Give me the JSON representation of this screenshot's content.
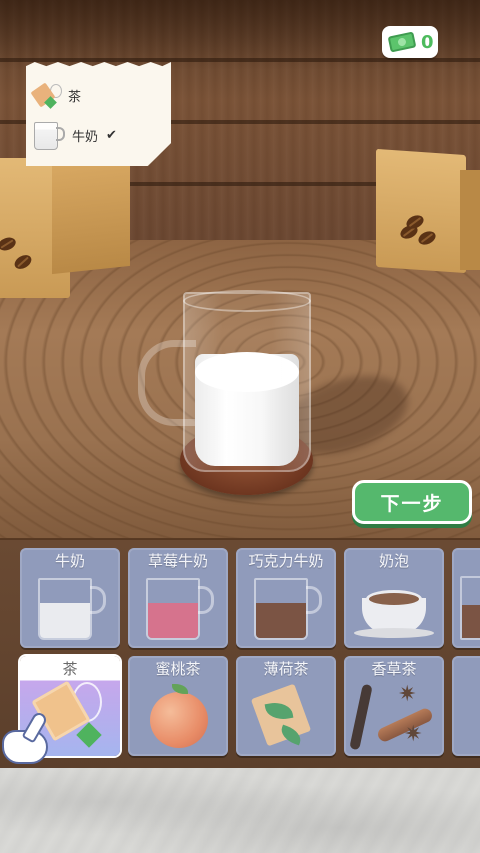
{
  "hud": {
    "money": "0",
    "money_icon": "cash-icon"
  },
  "recipe": {
    "items": [
      {
        "name": "茶",
        "icon": "tea-bag-icon",
        "checked": false
      },
      {
        "name": "牛奶",
        "icon": "milk-jug-icon",
        "checked": true,
        "check_mark": "✔"
      }
    ]
  },
  "next_button": {
    "label": "下一步"
  },
  "ingredients": {
    "row1": [
      {
        "label": "牛奶",
        "icon": "milk-pitcher-icon",
        "liquid_color": "#f2f2f2"
      },
      {
        "label": "草莓牛奶",
        "icon": "strawberry-milk-pitcher-icon",
        "liquid_color": "#d9607a"
      },
      {
        "label": "巧克力牛奶",
        "icon": "chocolate-milk-pitcher-icon",
        "liquid_color": "#6b3a22"
      },
      {
        "label": "奶泡",
        "icon": "milk-foam-cup-icon"
      }
    ],
    "row2": [
      {
        "label": "茶",
        "icon": "tea-bag-icon",
        "selected": true
      },
      {
        "label": "蜜桃茶",
        "icon": "peach-icon"
      },
      {
        "label": "薄荷茶",
        "icon": "mint-tea-bag-icon"
      },
      {
        "label": "香草茶",
        "icon": "vanilla-cinnamon-icon"
      }
    ]
  },
  "colors": {
    "accent_green": "#55b86d",
    "tile_blue": "#7d8bb2",
    "money_green": "#4dbb5d"
  }
}
